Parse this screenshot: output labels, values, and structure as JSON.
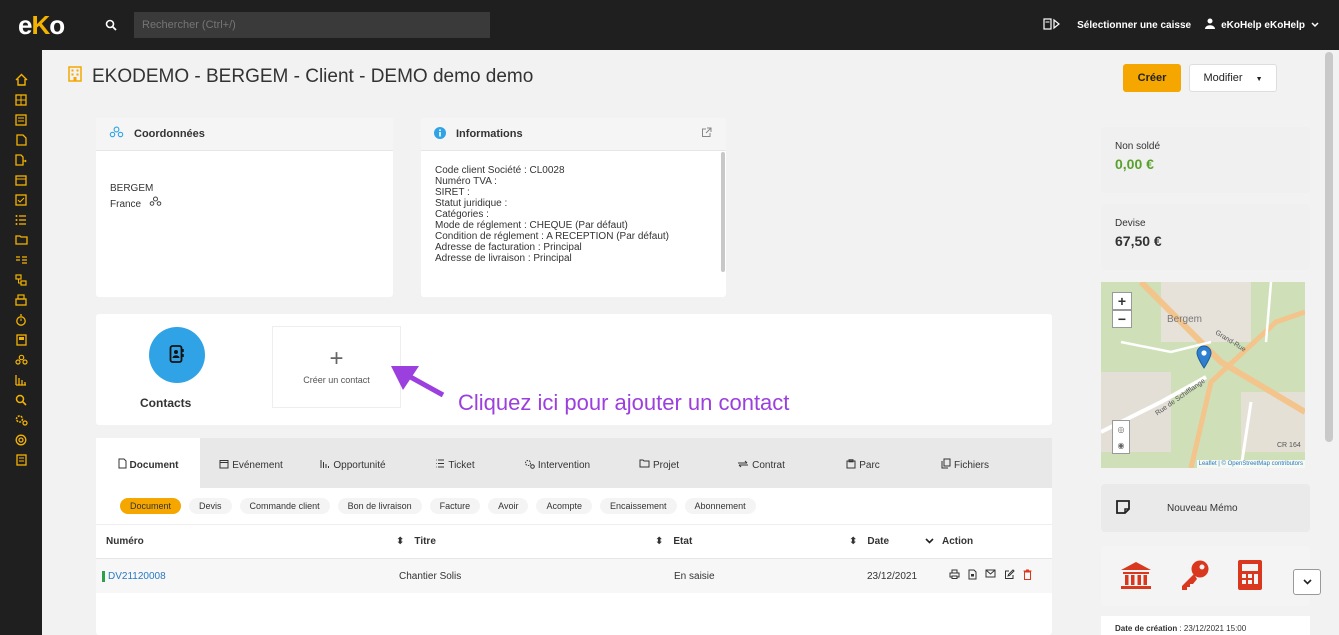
{
  "topbar": {
    "logo_e": "e",
    "logo_k": "K",
    "logo_o": "o",
    "search_placeholder": "Rechercher (Ctrl+/)",
    "caisse_label": "Sélectionner une caisse",
    "user_label": "eKoHelp eKoHelp"
  },
  "header": {
    "title": "EKODEMO - BERGEM - Client - DEMO demo demo",
    "create_label": "Créer",
    "modify_label": "Modifier"
  },
  "coordonnees": {
    "title": "Coordonnées",
    "city": "BERGEM",
    "country": "France"
  },
  "informations": {
    "title": "Informations",
    "lines": [
      {
        "k": "Code client Société",
        "v": " : CL0028"
      },
      {
        "k": "Numéro TVA",
        "v": " :"
      },
      {
        "k": "SIRET",
        "v": " :"
      },
      {
        "k": "Statut juridique",
        "v": " :"
      },
      {
        "k": "Catégories",
        "v": " :"
      },
      {
        "k": "Mode de réglement",
        "v": " : CHEQUE (Par défaut)"
      },
      {
        "k": "Condition de réglement",
        "v": " : A RECEPTION (Par défaut)"
      },
      {
        "k": "Adresse de facturation",
        "v": " : Principal"
      },
      {
        "k": "Adresse de livraison",
        "v": " : Principal"
      }
    ]
  },
  "contacts": {
    "label": "Contacts",
    "create_label": "Créer un contact",
    "annotation": "Cliquez ici pour ajouter un contact"
  },
  "tabs": [
    {
      "label": "Document",
      "active": true
    },
    {
      "label": "Evénement",
      "active": false
    },
    {
      "label": "Opportunité",
      "active": false
    },
    {
      "label": "Ticket",
      "active": false
    },
    {
      "label": "Intervention",
      "active": false
    },
    {
      "label": "Projet",
      "active": false
    },
    {
      "label": "Contrat",
      "active": false
    },
    {
      "label": "Parc",
      "active": false
    },
    {
      "label": "Fichiers",
      "active": false
    }
  ],
  "chips": [
    "Document",
    "Devis",
    "Commande client",
    "Bon de livraison",
    "Facture",
    "Avoir",
    "Acompte",
    "Encaissement",
    "Abonnement"
  ],
  "table": {
    "headers": {
      "numero": "Numéro",
      "titre": "Titre",
      "etat": "Etat",
      "date": "Date",
      "action": "Action"
    },
    "rows": [
      {
        "numero": "DV21120008",
        "titre": "Chantier Solis",
        "etat": "En saisie",
        "date": "23/12/2021"
      }
    ]
  },
  "right": {
    "nonsolde_label": "Non soldé",
    "nonsolde_value": "0,00 €",
    "devise_label": "Devise",
    "devise_value": "67,50 €",
    "map_place": "Bergem",
    "map_road1": "Grand-Rue",
    "map_road2": "Rue de Schifflange",
    "map_road3": "CR 164",
    "map_attrib": "Leaflet | © OpenStreetMap contributors",
    "memo_label": "Nouveau Mémo",
    "creation_label": "Date de création",
    "creation_value": " : 23/12/2021 15:00"
  },
  "colors": {
    "accent": "#f5a700",
    "topbar": "#1f1f1f",
    "link": "#2a79c2",
    "positive": "#5aa02c",
    "annotation": "#9b3fde",
    "tool_red": "#d9381e"
  }
}
